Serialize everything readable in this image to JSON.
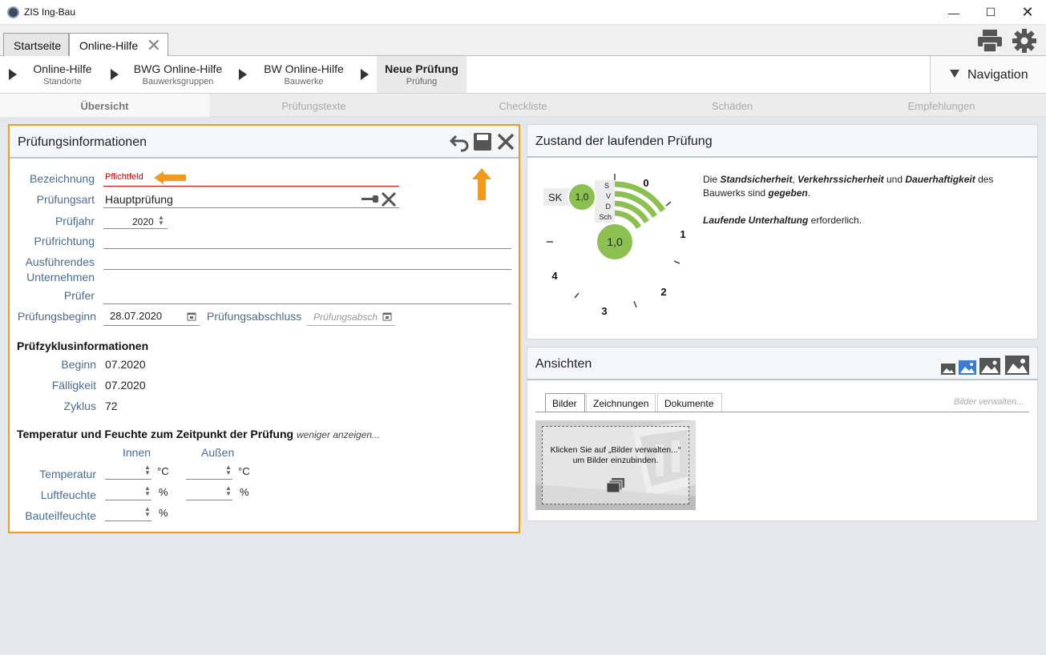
{
  "window": {
    "title": "ZIS Ing-Bau"
  },
  "tabs": [
    {
      "label": "Startseite"
    },
    {
      "label": "Online-Hilfe"
    }
  ],
  "breadcrumb": [
    {
      "main": "Online-Hilfe",
      "sub": "Standorte"
    },
    {
      "main": "BWG Online-Hilfe",
      "sub": "Bauwerksgruppen"
    },
    {
      "main": "BW Online-Hilfe",
      "sub": "Bauwerke"
    },
    {
      "main": "Neue Prüfung",
      "sub": "Prüfung"
    }
  ],
  "navigation_label": "Navigation",
  "subtabs": [
    "Übersicht",
    "Prüfungstexte",
    "Checkliste",
    "Schäden",
    "Empfehlungen"
  ],
  "pruefinfo": {
    "title": "Prüfungsinformationen",
    "bezeichnung_label": "Bezeichnung",
    "bezeichnung_placeholder": "Pflichtfeld",
    "pruefungsart_label": "Prüfungsart",
    "pruefungsart_value": "Hauptprüfung",
    "pruefjahr_label": "Prüfjahr",
    "pruefjahr_value": "2020",
    "pruefrichtung_label": "Prüfrichtung",
    "ausfuehrend_label_1": "Ausführendes",
    "ausfuehrend_label_2": "Unternehmen",
    "pruefer_label": "Prüfer",
    "beginn_label": "Prüfungsbeginn",
    "beginn_value": "28.07.2020",
    "abschluss_label": "Prüfungsabschluss",
    "abschluss_placeholder": "Prüfungsabsch"
  },
  "zyklus": {
    "title": "Prüfzyklusinformationen",
    "beginn_label": "Beginn",
    "beginn_value": "07.2020",
    "faelligkeit_label": "Fälligkeit",
    "faelligkeit_value": "07.2020",
    "zyklus_label": "Zyklus",
    "zyklus_value": "72"
  },
  "temperatur": {
    "title": "Temperatur und Feuchte zum Zeitpunkt der Prüfung",
    "toggle": "weniger anzeigen...",
    "col_innen": "Innen",
    "col_aussen": "Außen",
    "temp_label": "Temperatur",
    "luft_label": "Luftfeuchte",
    "bauteil_label": "Bauteilfeuchte",
    "unit_c": "°C",
    "unit_pct": "%"
  },
  "zustand": {
    "title": "Zustand der laufenden Prüfung",
    "sk_label": "SK",
    "sk_value": "1,0",
    "main_value": "1,0",
    "bar_labels": [
      "S",
      "V",
      "D",
      "Sch"
    ],
    "scale_labels": [
      "0",
      "1",
      "2",
      "3",
      "4"
    ],
    "text1_a": "Die ",
    "text1_b": "Standsicherheit",
    "text1_c": ", ",
    "text1_d": "Verkehrssicherheit",
    "text1_e": " und ",
    "text1_f": "Dauerhaftigkeit",
    "text1_g": " des Bauwerks sind ",
    "text1_h": "gegeben",
    "text1_i": ".",
    "text2_a": "Laufende Unterhaltung",
    "text2_b": " erforderlich."
  },
  "ansichten": {
    "title": "Ansichten",
    "tabs": [
      "Bilder",
      "Zeichnungen",
      "Dokumente"
    ],
    "manage_link": "Bilder verwalten...",
    "placeholder_line1": "Klicken Sie auf „Bilder verwalten...“",
    "placeholder_line2": "um Bilder einzubinden."
  },
  "colors": {
    "accent_orange": "#f39a1c",
    "green": "#8cc152",
    "label_blue": "#4a6c93",
    "required_red": "#d00000"
  }
}
